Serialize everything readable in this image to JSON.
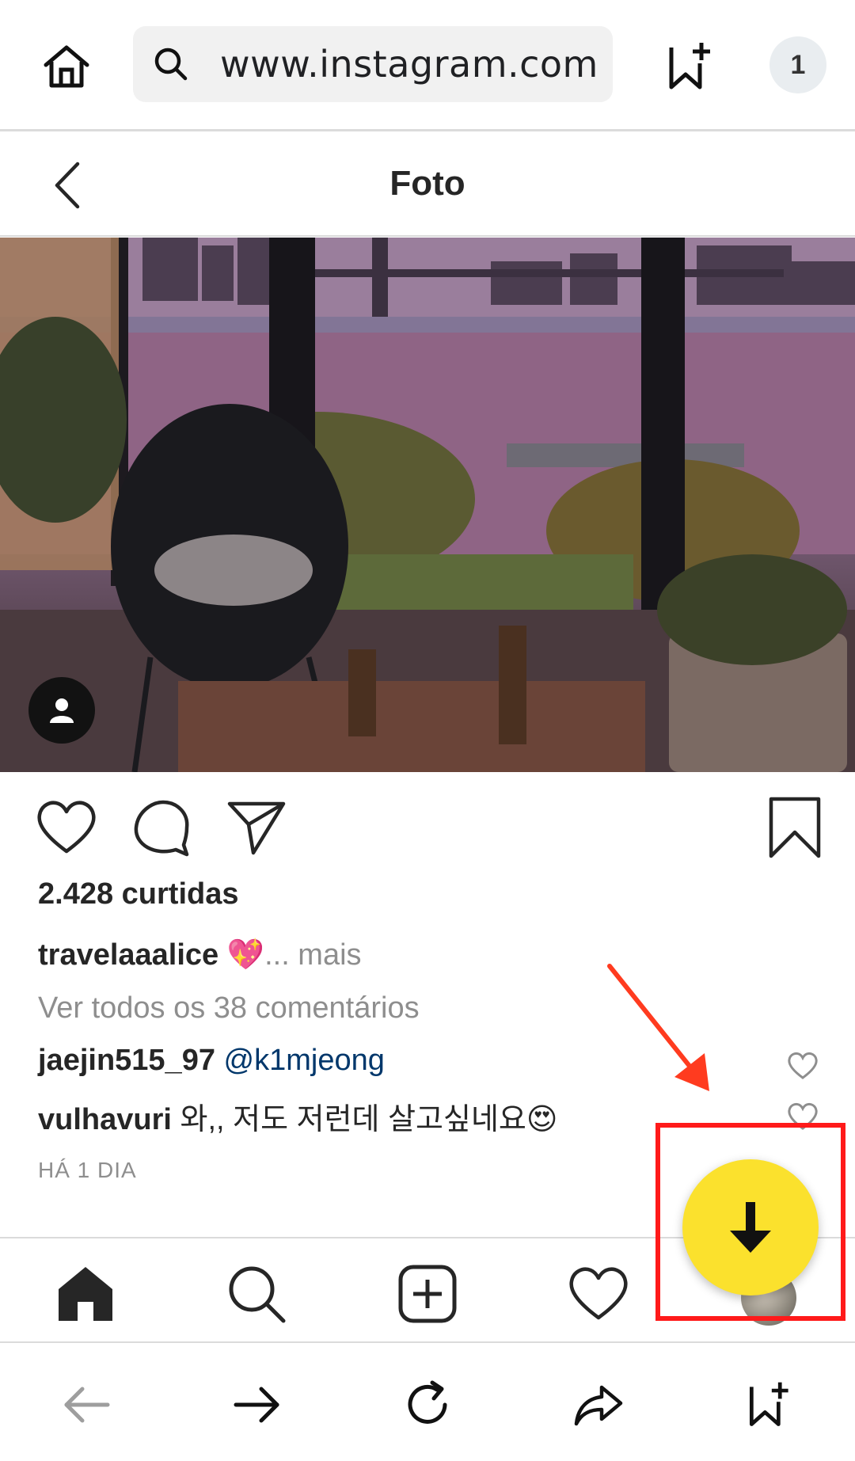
{
  "browser": {
    "url": "www.instagram.com",
    "tab_count": "1"
  },
  "header": {
    "title": "Foto"
  },
  "post": {
    "likes": "2.428 curtidas",
    "caption_user": "travelaaalice",
    "caption_emoji": "💖",
    "caption_more": "... mais",
    "view_all_comments": "Ver todos os 38 comentários",
    "comments": [
      {
        "user": "jaejin515_97",
        "text": "@k1mjeong"
      },
      {
        "user": "vulhavuri",
        "text": "와,, 저도 저런데 살고싶네요😍"
      }
    ],
    "timestamp": "HÁ 1 DIA"
  },
  "icons": {
    "browser_home": "home-icon",
    "url_search": "search-icon",
    "bookmark_add": "bookmark-add-icon",
    "back": "chevron-left-icon",
    "like": "heart-icon",
    "comment": "comment-icon",
    "share": "send-icon",
    "save": "bookmark-icon",
    "nav": [
      "home-icon",
      "search-icon",
      "add-post-icon",
      "heart-icon",
      "avatar"
    ],
    "browser_nav": [
      "back-arrow-icon",
      "forward-arrow-icon",
      "reload-icon",
      "share-icon",
      "bookmark-add-icon"
    ],
    "download": "download-arrow-icon"
  },
  "colors": {
    "download_button": "#fbe12d",
    "highlight": "#ff1a1a",
    "mention": "#00376b",
    "muted_text": "#8e8e8e"
  }
}
